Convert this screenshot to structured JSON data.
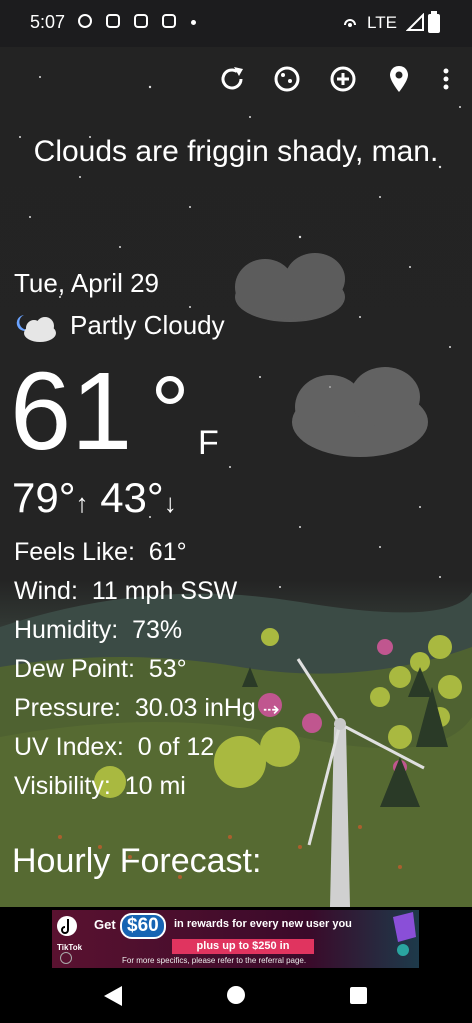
{
  "status_bar": {
    "time": "5:07",
    "network": "LTE"
  },
  "toolbar": {
    "icons": [
      "refresh-icon",
      "moon-phase-icon",
      "add-location-icon",
      "location-pin-icon",
      "more-vert-icon"
    ]
  },
  "quote": "Clouds are friggin shady, man.",
  "current": {
    "date": "Tue, April 29",
    "condition": "Partly Cloudy",
    "temperature": "61",
    "degree_symbol": "°",
    "unit": "F",
    "high": "79°",
    "low": "43°",
    "high_arrow": "↑",
    "low_arrow": "↓"
  },
  "details": [
    {
      "label": "Feels Like:",
      "value": "61°"
    },
    {
      "label": "Wind:",
      "value": "11 mph SSW"
    },
    {
      "label": "Humidity:",
      "value": "73%"
    },
    {
      "label": "Dew Point:",
      "value": "53°"
    },
    {
      "label": "Pressure:",
      "value": "30.03 inHg",
      "suffix": "⇢"
    },
    {
      "label": "UV Index:",
      "value": "0 of 12"
    },
    {
      "label": "Visibility:",
      "value": "10 mi"
    }
  ],
  "hourly_title": "Hourly Forecast:",
  "ad": {
    "brand": "TikTok",
    "line1_pre": "Get",
    "line1_amount": "$60",
    "line1_post": "in rewards for every new user you",
    "line2": "plus up to $250 in",
    "footnote": "For more specifics, please refer to the referral page."
  }
}
